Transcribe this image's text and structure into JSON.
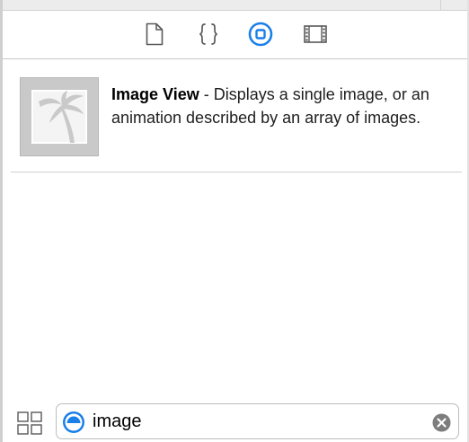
{
  "library": {
    "tabs": [
      {
        "name": "file-template-library",
        "icon": "document-icon",
        "selected": false
      },
      {
        "name": "code-snippet-library",
        "icon": "braces-icon",
        "selected": false
      },
      {
        "name": "object-library",
        "icon": "object-icon",
        "selected": true
      },
      {
        "name": "media-library",
        "icon": "film-icon",
        "selected": false
      }
    ],
    "items": [
      {
        "title": "Image View",
        "separator": " - ",
        "description": "Displays a single image, or an animation described by an array of images.",
        "icon": "palm-tree-image-icon"
      }
    ]
  },
  "filter": {
    "value": "image",
    "icon": "object-filter-icon",
    "clear_icon": "clear-icon"
  },
  "colors": {
    "accent": "#1a7fe8",
    "icon_gray": "#595959",
    "thumb_bg": "#c9c9c9",
    "clear_gray": "#7d7d7d"
  }
}
